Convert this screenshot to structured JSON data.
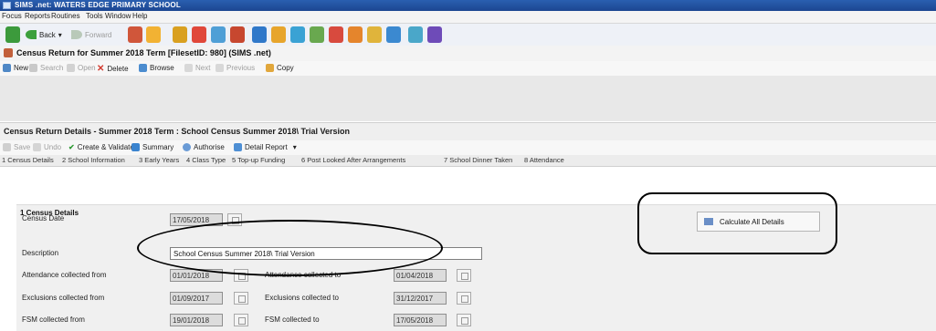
{
  "window": {
    "title": "SIMS .net: WATERS EDGE PRIMARY SCHOOL"
  },
  "menu": [
    "Focus",
    "Reports",
    "Routines",
    "Tools",
    "Window",
    "Help"
  ],
  "toolbar": {
    "back": "Back",
    "forward": "Forward"
  },
  "fileset": {
    "title": "Census Return for Summer 2018 Term [FilesetID: 980] (SIMS .net)",
    "actions": [
      "New",
      "Search",
      "Open",
      "Delete",
      "Browse",
      "Next",
      "Previous",
      "Copy"
    ]
  },
  "details": {
    "title": "Census Return Details - Summer 2018 Term : School Census Summer 2018\\ Trial Version",
    "actions": [
      "Save",
      "Undo",
      "Create & Validate",
      "Summary",
      "Authorise",
      "Detail Report"
    ]
  },
  "tabs": [
    "1 Census Details",
    "2 School Information",
    "3 Early Years",
    "4 Class Type",
    "5 Top-up Funding",
    "6 Post Looked After Arrangements",
    "7 School Dinner Taken",
    "8 Attendance"
  ],
  "section": {
    "title": "1 Census Details",
    "census_date_label": "Census Date",
    "census_date": "17/05/2018",
    "description_label": "Description",
    "description": "School Census Summer 2018\\ Trial Version",
    "att_from_label": "Attendance collected from",
    "att_from": "01/01/2018",
    "att_to_label": "Attendance collected to",
    "att_to": "01/04/2018",
    "exc_from_label": "Exclusions collected from",
    "exc_from": "01/09/2017",
    "exc_to_label": "Exclusions collected to",
    "exc_to": "31/12/2017",
    "fsm_from_label": "FSM collected from",
    "fsm_from": "19/01/2018",
    "fsm_to_label": "FSM collected to",
    "fsm_to": "17/05/2018",
    "calculate_label": "Calculate All Details"
  }
}
